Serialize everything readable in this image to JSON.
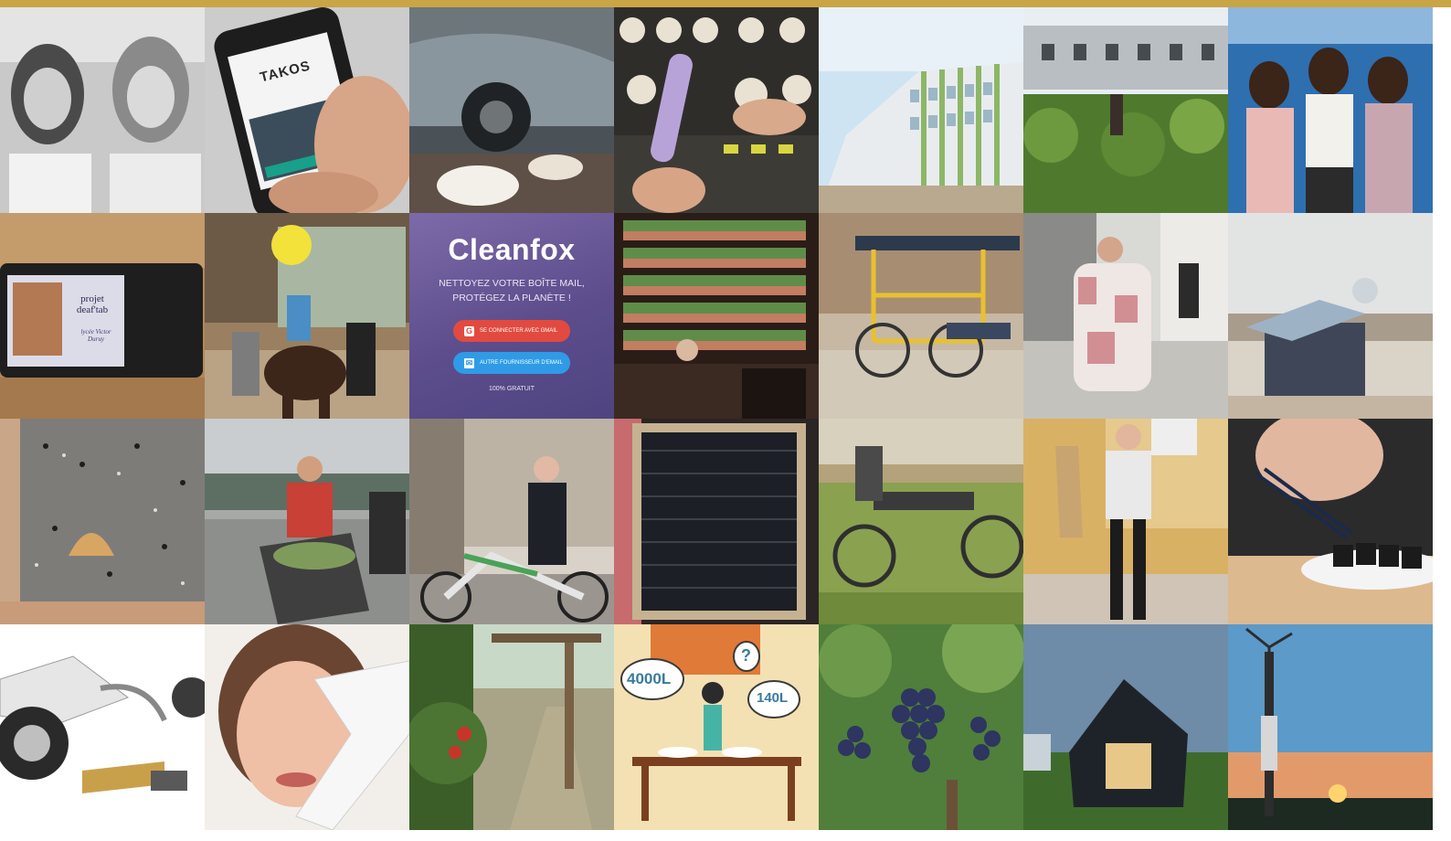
{
  "accent_bar_color": "#c9a545",
  "tiles": {
    "deaftab": {
      "line1": "projet",
      "line2": "deaf'tab",
      "line3": "lycée Victor Duruy"
    },
    "phone_app": {
      "logo": "TAKOS"
    },
    "cleanfox": {
      "title": "Cleanfox",
      "subtitle": "NETTOYEZ VOTRE BOÎTE MAIL, PROTÉGEZ LA PLANÈTE !",
      "btn_gmail": "SE CONNECTER AVEC GMAIL",
      "btn_other": "AUTRE FOURNISSEUR D'EMAIL",
      "free": "100% GRATUIT"
    },
    "water_illustration": {
      "bubble_left": "4000L",
      "bubble_right": "140L",
      "question": "?"
    }
  }
}
